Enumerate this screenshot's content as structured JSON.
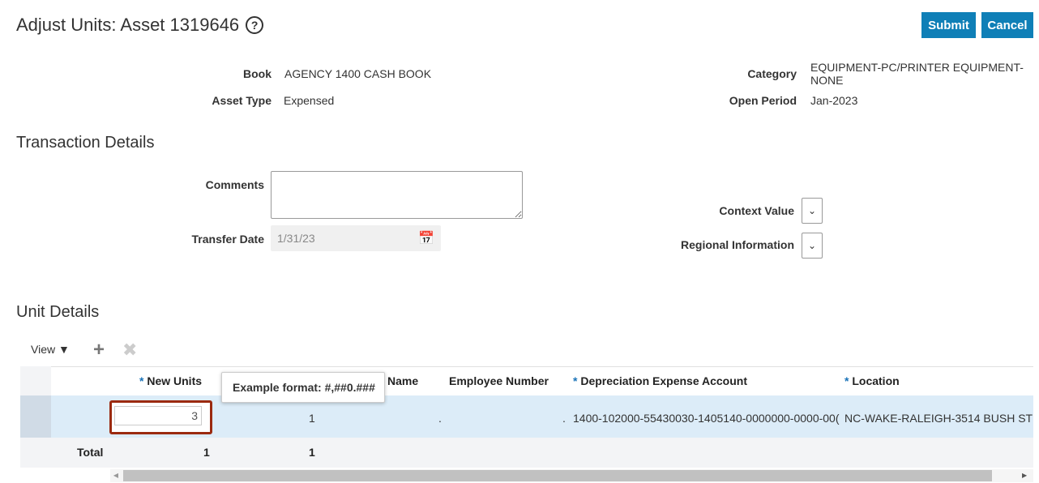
{
  "header": {
    "title": "Adjust Units: Asset 1319646",
    "submit_label": "Submit",
    "cancel_label": "Cancel"
  },
  "asset": {
    "book_label": "Book",
    "book_value": "AGENCY 1400 CASH BOOK",
    "asset_type_label": "Asset Type",
    "asset_type_value": "Expensed",
    "category_label": "Category",
    "category_value_1": "EQUIPMENT-PC/PRINTER EQUIPMENT-",
    "category_value_2": "NONE",
    "open_period_label": "Open Period",
    "open_period_value": "Jan-2023"
  },
  "transaction": {
    "title": "Transaction Details",
    "comments_label": "Comments",
    "comments_value": "",
    "transfer_date_label": "Transfer Date",
    "transfer_date_value": "1/31/23",
    "context_value_label": "Context Value",
    "regional_info_label": "Regional Information"
  },
  "units": {
    "title": "Unit Details",
    "view_label": "View",
    "columns": [
      "New Units",
      "Name",
      "Employee Number",
      "Depreciation Expense Account",
      "Location"
    ],
    "row": {
      "new_units": "3",
      "current_units": "1",
      "name": ".",
      "employee_number": ".",
      "account": "1400-102000-55430030-1405140-0000000-0000-00(",
      "location": "NC-WAKE-RALEIGH-3514 BUSH ST"
    },
    "total_label": "Total",
    "total_new": "1",
    "total_current": "1",
    "tooltip": "Example format: #,##0.###"
  },
  "colors": {
    "accent": "#0f7fb7",
    "selected_row": "#dcecf8",
    "error_border": "#9b2a10"
  }
}
